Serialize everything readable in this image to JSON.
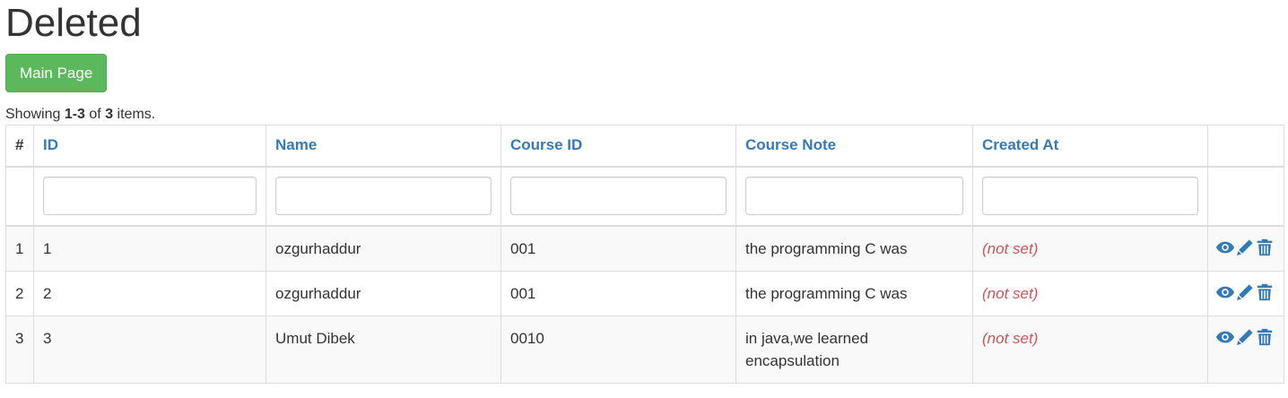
{
  "page": {
    "title": "Deleted",
    "main_button": "Main Page"
  },
  "summary": {
    "prefix": "Showing ",
    "range": "1-3",
    "middle": " of ",
    "total": "3",
    "suffix": " items."
  },
  "table": {
    "columns": [
      "#",
      "ID",
      "Name",
      "Course ID",
      "Course Note",
      "Created At"
    ],
    "rows": [
      {
        "num": "1",
        "id": "1",
        "name": "ozgurhaddur",
        "course_id": "001",
        "course_note": "the programming C was",
        "created_at": "(not set)"
      },
      {
        "num": "2",
        "id": "2",
        "name": "ozgurhaddur",
        "course_id": "001",
        "course_note": "the programming C was",
        "created_at": "(not set)"
      },
      {
        "num": "3",
        "id": "3",
        "name": "Umut Dibek",
        "course_id": "0010",
        "course_note": "in java,we learned encapsulation",
        "created_at": "(not set)"
      }
    ],
    "action_icons": [
      "eye-icon",
      "pencil-icon",
      "trash-icon"
    ]
  },
  "colors": {
    "button": "#5cb85c",
    "link": "#337ab7",
    "not_set": "#c55555",
    "stripe": "#f9f9f9",
    "border": "#dddddd"
  }
}
